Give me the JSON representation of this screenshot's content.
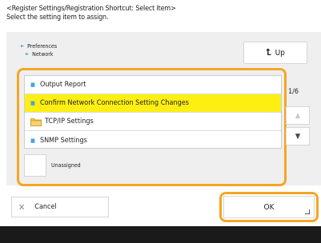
{
  "header": {
    "line1": "<Register Settings/Registration Shortcut: Select Item>",
    "line2": "Select the setting item to assign."
  },
  "breadcrumb": {
    "parent": "Preferences",
    "current": "Network"
  },
  "up_button": {
    "label": "Up",
    "icon": "up-arrow-icon"
  },
  "list": {
    "items": [
      {
        "label": "Output Report",
        "icon": "bullet",
        "selected": false
      },
      {
        "label": "Confirm Network Connection Setting Changes",
        "icon": "bullet",
        "selected": true
      },
      {
        "label": "TCP/IP Settings",
        "icon": "folder-icon",
        "selected": false
      },
      {
        "label": "SNMP Settings",
        "icon": "bullet",
        "selected": false
      }
    ]
  },
  "pager": {
    "text": "1/6"
  },
  "unassigned": {
    "label": "Unassigned"
  },
  "footer": {
    "cancel_label": "Cancel",
    "ok_label": "OK"
  },
  "colors": {
    "highlight": "#f5a623",
    "selected_row": "#fdef12",
    "bullet": "#4aa3e0"
  }
}
